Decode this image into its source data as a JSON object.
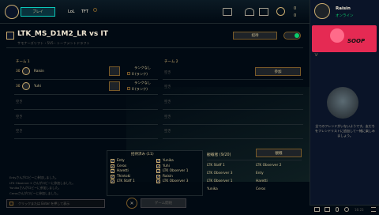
{
  "topbar": {
    "play_label": "プレイ",
    "nav": [
      "LoL",
      "TFT"
    ],
    "currency": [
      "0",
      "0"
    ],
    "username": "Raisin",
    "status": "オンライン"
  },
  "lobby": {
    "title": "LTK_MS_D1M2_LR vs IT",
    "subtitle": "サモナーズリフト・5V5・トーナメントドラフト",
    "invite_label": "招待",
    "team1_label": "チーム 1",
    "team2_label": "チーム 2",
    "join_label": "参加",
    "team1_players": [
      {
        "level": "30",
        "name": "Raisin",
        "rank_line1": "ランクなし",
        "rank_line2": "0 (ランク)"
      },
      {
        "level": "30",
        "name": "Yuhi",
        "rank_line1": "ランクなし",
        "rank_line2": "0 (ランク)"
      },
      {
        "name": "空き"
      },
      {
        "name": "空き"
      },
      {
        "name": "空き"
      }
    ],
    "team2_players": [
      "空き",
      "空き",
      "空き",
      "空き",
      "空き"
    ]
  },
  "chat": {
    "messages": [
      "Entyさんがロビーに参加しました。",
      "LTK Observer 2 さんがロビーに参加しました。",
      "Yunikaさんがロビーに参加しました。",
      "Cerosさんがロビーに参加しました。"
    ],
    "input_placeholder": "クリックまたは Enter を押して表示"
  },
  "invited": {
    "header": "招待済み (11)",
    "names": [
      "Enty",
      "Yunika",
      "Ceros",
      "Yuhi",
      "Haretti",
      "LTK Observer 1",
      "Thintoki",
      "Raisin",
      "LTK Staff 1",
      "LTK Observer 3"
    ]
  },
  "spectators": {
    "header": "観戦者 (9/20)",
    "button": "観戦",
    "names": [
      "LTK Staff 1",
      "LTK Observer 2",
      "LTK Observer 3",
      "Enty",
      "LTK Observer 1",
      "Haretti",
      "Yunika",
      "Ceros"
    ]
  },
  "start_button": "ゲーム開始",
  "social": {
    "brand": "SOOP",
    "empty_message": "全てのフレンドがいないようです。友だちをフレンドリストに追加して一緒に楽しみましょう。",
    "tab_label": "ソ",
    "time": "16:23"
  }
}
